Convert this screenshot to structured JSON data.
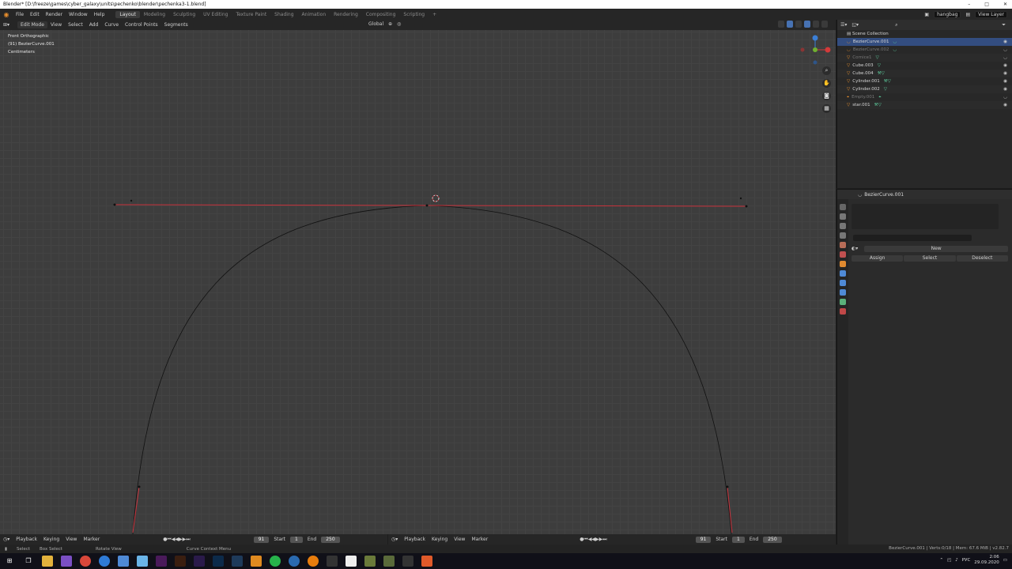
{
  "window": {
    "title": "Blender* [D:\\freeze\\games\\cyber_galaxy\\units\\pechenko\\blender\\pechenka3-1.blend]",
    "buttons": [
      "–",
      "□",
      "✕"
    ]
  },
  "menu": {
    "items": [
      "File",
      "Edit",
      "Render",
      "Window",
      "Help"
    ],
    "workspaces": [
      "Layout",
      "Modeling",
      "Sculpting",
      "UV Editing",
      "Texture Paint",
      "Shading",
      "Animation",
      "Rendering",
      "Compositing",
      "Scripting"
    ],
    "active_workspace": "Layout",
    "add_tab": "+",
    "scene": "hangbag",
    "view_layer": "View Layer"
  },
  "viewport_header": {
    "mode": "Edit Mode",
    "items": [
      "View",
      "Select",
      "Add",
      "Curve",
      "Control Points",
      "Segments"
    ],
    "orientation": "Global"
  },
  "viewport": {
    "view_name": "Front Orthographic",
    "object_info": "(91) BezierCurve.001",
    "units": "Centimeters"
  },
  "outliner": {
    "root": "Scene Collection",
    "items": [
      {
        "name": "BezierCurve.001",
        "selected": true,
        "dim": false
      },
      {
        "name": "BezierCurve.002",
        "selected": false,
        "dim": true
      },
      {
        "name": "Cornice1",
        "selected": false,
        "dim": true
      },
      {
        "name": "Cube.003",
        "selected": false,
        "dim": false
      },
      {
        "name": "Cube.004",
        "selected": false,
        "dim": false
      },
      {
        "name": "Cylinder.001",
        "selected": false,
        "dim": false
      },
      {
        "name": "Cylinder.002",
        "selected": false,
        "dim": false
      },
      {
        "name": "Empty.001",
        "selected": false,
        "dim": true
      },
      {
        "name": "star.001",
        "selected": false,
        "dim": false
      }
    ]
  },
  "properties": {
    "object_name": "BezierCurve.001",
    "new_label": "New",
    "assign_label": "Assign",
    "select_label": "Select",
    "deselect_label": "Deselect"
  },
  "timeline": {
    "items": [
      "Playback",
      "Keying",
      "View",
      "Marker"
    ],
    "current_frame": "91",
    "start_label": "Start",
    "start": "1",
    "end_label": "End",
    "end": "250"
  },
  "statusbar": {
    "select": "Select",
    "box_select": "Box Select",
    "rotate_view": "Rotate View",
    "context_menu": "Curve Context Menu",
    "stats": "BezierCurve.001 | Verts:0/18 | Mem: 67.6 MiB | v2.82.7"
  },
  "taskbar": {
    "language": "РУС",
    "time": "2:06",
    "date": "29.09.2020"
  },
  "colors": {
    "accent": "#e88f2e",
    "selection": "#334d80",
    "handle_line": "#c8323c"
  }
}
